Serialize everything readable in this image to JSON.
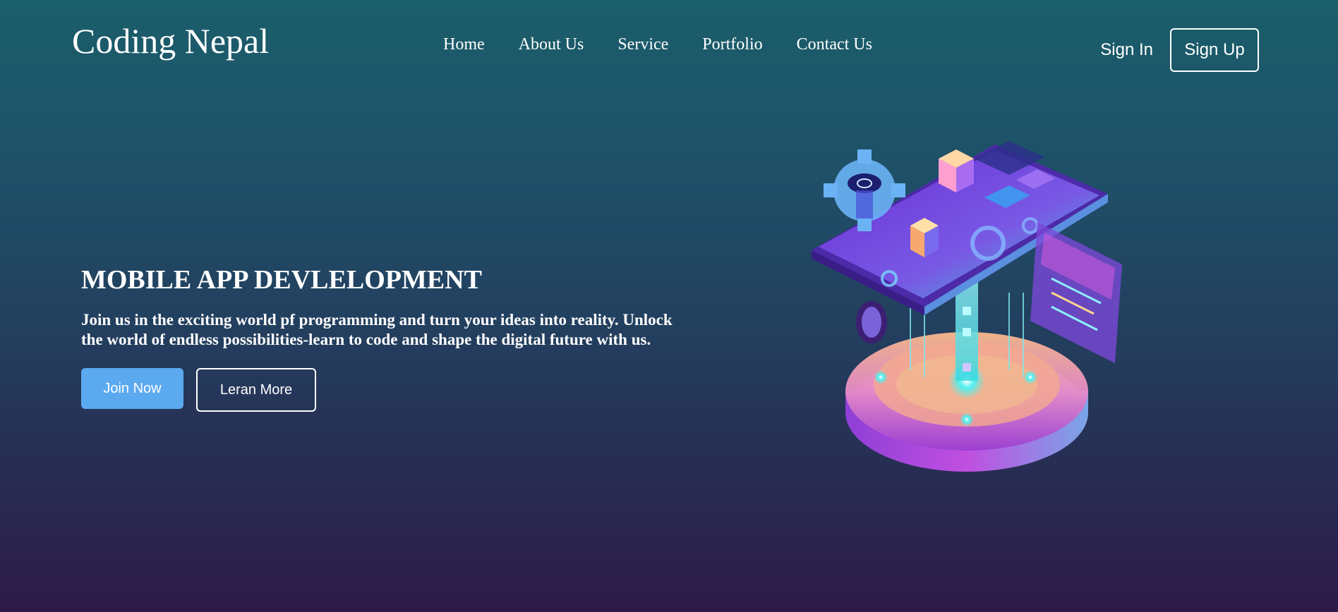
{
  "header": {
    "logo": "Coding Nepal",
    "nav": [
      "Home",
      "About Us",
      "Service",
      "Portfolio",
      "Contact Us"
    ],
    "sign_in": "Sign In",
    "sign_up": "Sign Up"
  },
  "hero": {
    "title": "MOBILE APP DEVLELOPMENT",
    "description": "Join us in the exciting world pf programming and turn your ideas into reality. Unlock the world of endless possibilities-learn to code and shape the digital future with us.",
    "join_label": "Join Now",
    "learn_label": "Leran More"
  },
  "illustration": {
    "icon": "isometric-mobile-app-illustration"
  },
  "colors": {
    "background_top": "#1a5e6b",
    "background_bottom": "#2d1a47",
    "primary_button": "#5ba9ef",
    "text": "#ffffff"
  }
}
